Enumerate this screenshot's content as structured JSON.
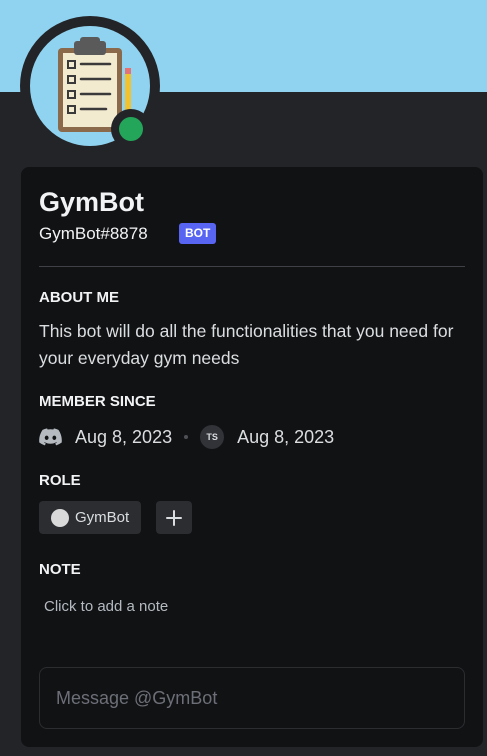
{
  "banner": {
    "color": "#8fd3f0"
  },
  "profile": {
    "avatar_icon": "clipboard-checklist-icon",
    "status": "online",
    "display_name": "GymBot",
    "username": "GymBot#8878",
    "bot_tag": "BOT"
  },
  "about": {
    "title": "ABOUT ME",
    "text": "This bot will do all the functionalities that you need for your everyday gym needs"
  },
  "member_since": {
    "title": "MEMBER SINCE",
    "discord_date": "Aug 8, 2023",
    "server_initials": "TS",
    "server_date": "Aug 8, 2023"
  },
  "roles": {
    "title": "ROLE",
    "items": [
      {
        "name": "GymBot",
        "color": "#d9d9d9"
      }
    ],
    "add_icon": "plus-icon"
  },
  "note": {
    "title": "NOTE",
    "placeholder": "Click to add a note"
  },
  "message": {
    "placeholder": "Message @GymBot"
  },
  "colors": {
    "accent": "#5865f2",
    "online": "#23a55a",
    "card_bg": "#111214",
    "panel_bg": "#232428"
  }
}
